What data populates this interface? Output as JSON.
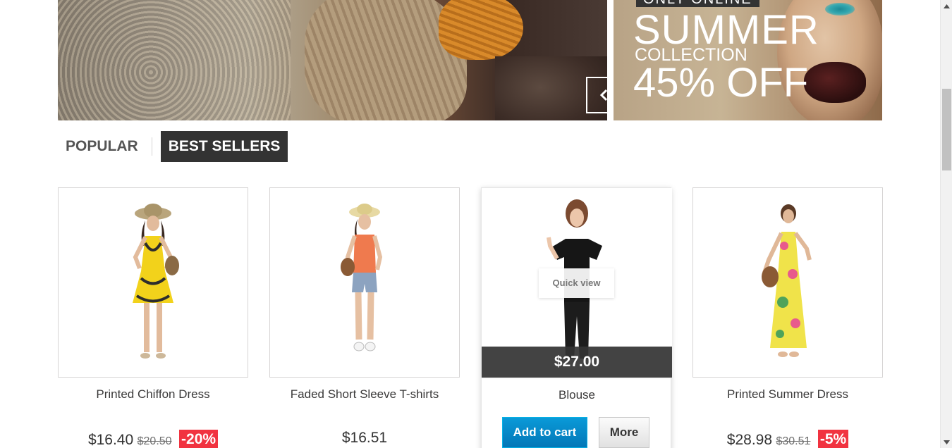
{
  "banner": {
    "prev_icon": "chevron-left-icon",
    "next_icon": "chevron-right-icon"
  },
  "promo": {
    "tag": "ONLY ONLINE",
    "headline": "SUMMER",
    "subline": "COLLECTION",
    "offer": "45% OFF"
  },
  "tabs": [
    {
      "label": "POPULAR",
      "active": false
    },
    {
      "label": "BEST SELLERS",
      "active": true
    }
  ],
  "products": [
    {
      "name": "Printed Chiffon Dress",
      "price": "$16.40",
      "old_price": "$20.50",
      "discount": "-20%"
    },
    {
      "name": "Faded Short Sleeve T-shirts",
      "price": "$16.51"
    },
    {
      "name": "Blouse",
      "price": "$27.00",
      "quick_view": "Quick view",
      "add_to_cart": "Add to cart",
      "more": "More"
    },
    {
      "name": "Printed Summer Dress",
      "price": "$28.98",
      "old_price": "$30.51",
      "discount": "-5%"
    }
  ],
  "colors": {
    "accent_blue": "#0377b7",
    "sale_red": "#f13340",
    "dark": "#333333"
  }
}
